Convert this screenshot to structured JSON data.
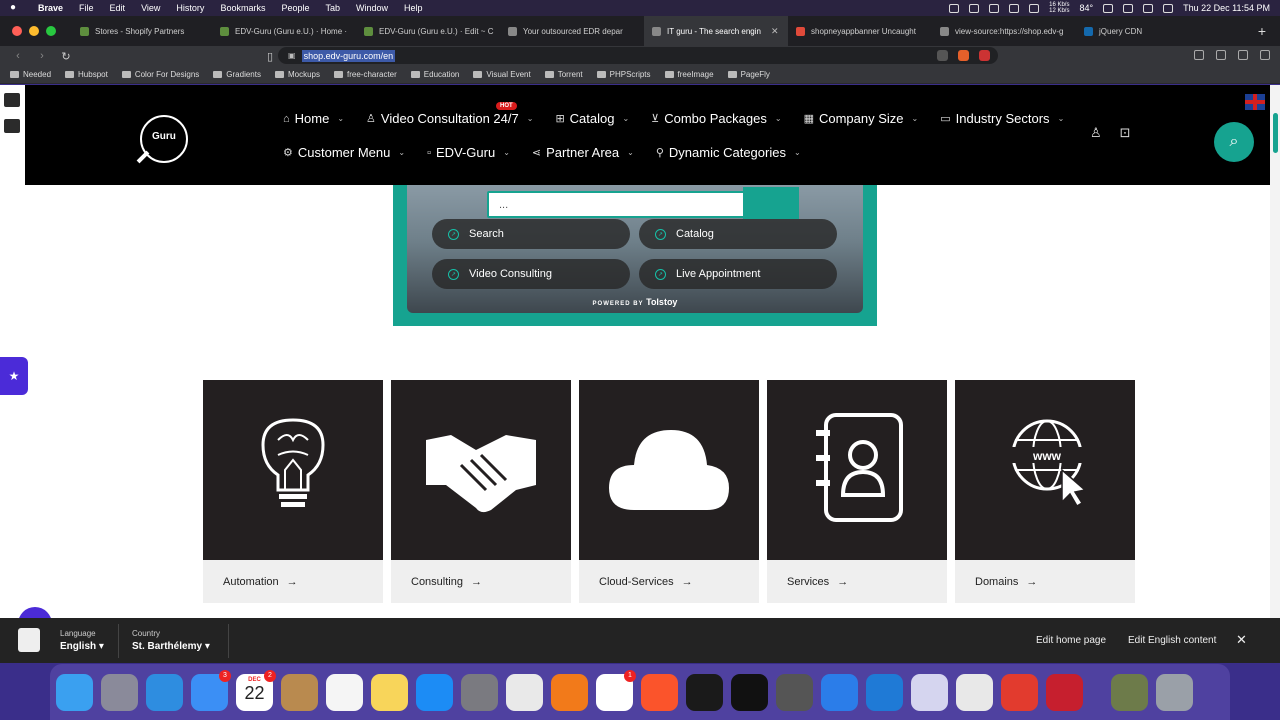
{
  "menubar": {
    "app": "Brave",
    "items": [
      "File",
      "Edit",
      "View",
      "History",
      "Bookmarks",
      "People",
      "Tab",
      "Window",
      "Help"
    ],
    "net_up": "16 Kb/s",
    "net_down": "12 Kb/s",
    "temp": "84°",
    "clock": "Thu 22 Dec  11:54 PM"
  },
  "tabs": [
    {
      "title": "Stores - Shopify Partners",
      "fav": "#5e8e3e"
    },
    {
      "title": "EDV-Guru (Guru e.U.) · Home ·",
      "fav": "#5e8e3e"
    },
    {
      "title": "EDV-Guru (Guru e.U.) · Edit ~ C",
      "fav": "#5e8e3e"
    },
    {
      "title": "Your outsourced EDR depar",
      "fav": "#888888"
    },
    {
      "title": "IT guru - The search engin",
      "fav": "#888888",
      "active": true
    },
    {
      "title": "shopneyappbanner Uncaught",
      "fav": "#e04a3a"
    },
    {
      "title": "view-source:https://shop.edv-g",
      "fav": "#888888"
    },
    {
      "title": "jQuery CDN",
      "fav": "#1469ad"
    }
  ],
  "address": {
    "url": "shop.edv-guru.com/en"
  },
  "bookmarks": [
    "Needed",
    "Hubspot",
    "Color For Designs",
    "Gradients",
    "Mockups",
    "free-character",
    "Education",
    "Visual Event",
    "Torrent",
    "PHPScripts",
    "freeImage",
    "PageFly"
  ],
  "nav": {
    "row1": [
      {
        "label": "Home",
        "icon": "home-icon",
        "glyph": "⌂"
      },
      {
        "label": "Video Consultation 24/7",
        "icon": "user-icon",
        "glyph": "♙"
      },
      {
        "label": "Catalog",
        "icon": "grid-icon",
        "glyph": "⊞"
      },
      {
        "label": "Combo Packages",
        "icon": "cart-icon",
        "glyph": "⊻"
      },
      {
        "label": "Company Size",
        "icon": "building-icon",
        "glyph": "▦"
      },
      {
        "label": "Industry Sectors",
        "icon": "briefcase-icon",
        "glyph": "▭"
      }
    ],
    "row2": [
      {
        "label": "Customer Menu",
        "icon": "palette-icon",
        "glyph": "⚙"
      },
      {
        "label": "EDV-Guru",
        "icon": "dot-icon",
        "glyph": "▫"
      },
      {
        "label": "Partner Area",
        "icon": "share-icon",
        "glyph": "⋖"
      },
      {
        "label": "Dynamic Categories",
        "icon": "badge-icon",
        "glyph": "⚲"
      }
    ],
    "hot": "HOT"
  },
  "logo": {
    "text": "Guru"
  },
  "widget": {
    "search_value": "...",
    "buttons": [
      "Search",
      "Catalog",
      "Video Consulting",
      "Live Appointment"
    ],
    "powered": "POWERED BY",
    "brand": "Tolstoy"
  },
  "cards": [
    {
      "label": "Automation",
      "icon": "brain-bulb-icon"
    },
    {
      "label": "Consulting",
      "icon": "handshake-icon"
    },
    {
      "label": "Cloud-Services",
      "icon": "cloud-icon"
    },
    {
      "label": "Services",
      "icon": "address-book-icon"
    },
    {
      "label": "Domains",
      "icon": "globe-www-icon"
    }
  ],
  "shopbar": {
    "language_label": "Language",
    "language_value": "English",
    "country_label": "Country",
    "country_value": "St. Barthélemy",
    "edit_home": "Edit home page",
    "edit_content": "Edit English content"
  },
  "dock": {
    "calendar_month": "DEC",
    "calendar_day": "22",
    "mail_badge": "3",
    "calendar_badge": "2",
    "slack_badge": "1"
  }
}
